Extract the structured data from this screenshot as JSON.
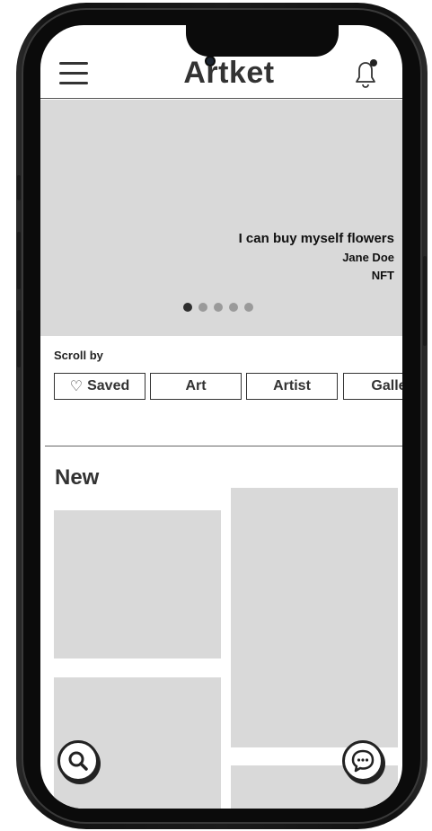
{
  "header": {
    "title": "Artket",
    "menu_icon": "hamburger-menu-icon",
    "notification_icon": "bell-icon"
  },
  "hero": {
    "title": "I can buy myself flowers",
    "artist": "Jane Doe",
    "type": "NFT",
    "slide_count": 5,
    "active_slide": 1
  },
  "filters": {
    "label": "Scroll by",
    "chips": [
      {
        "label": "Saved",
        "icon": "heart-icon"
      },
      {
        "label": "Art"
      },
      {
        "label": "Artist"
      },
      {
        "label": "Galle"
      }
    ]
  },
  "new_section": {
    "title": "New"
  },
  "fabs": {
    "search_icon": "search-icon",
    "chat_icon": "chat-bubble-icon"
  },
  "colors": {
    "placeholder": "#d9d9d9",
    "text": "#333333",
    "active_dot": "#2e2e2e",
    "inactive_dot": "#9a9a9a"
  }
}
